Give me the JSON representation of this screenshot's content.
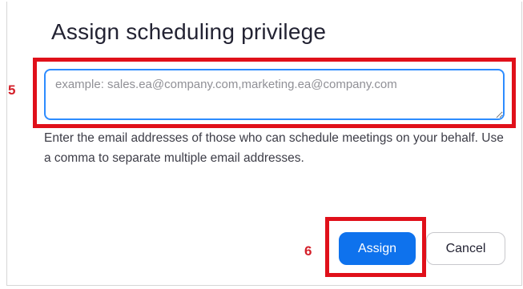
{
  "dialog": {
    "title": "Assign scheduling privilege",
    "email_input": {
      "value": "",
      "placeholder": "example: sales.ea@company.com,marketing.ea@company.com"
    },
    "helper_text": "Enter the email addresses of those who can schedule meetings on your behalf. Use a comma to separate multiple email addresses.",
    "buttons": {
      "assign_label": "Assign",
      "cancel_label": "Cancel"
    }
  },
  "annotations": {
    "step_email": "5",
    "step_assign": "6"
  },
  "colors": {
    "primary_button": "#0e72ed",
    "input_focus_border": "#2d8cff",
    "annotation_red": "#e0101a"
  }
}
